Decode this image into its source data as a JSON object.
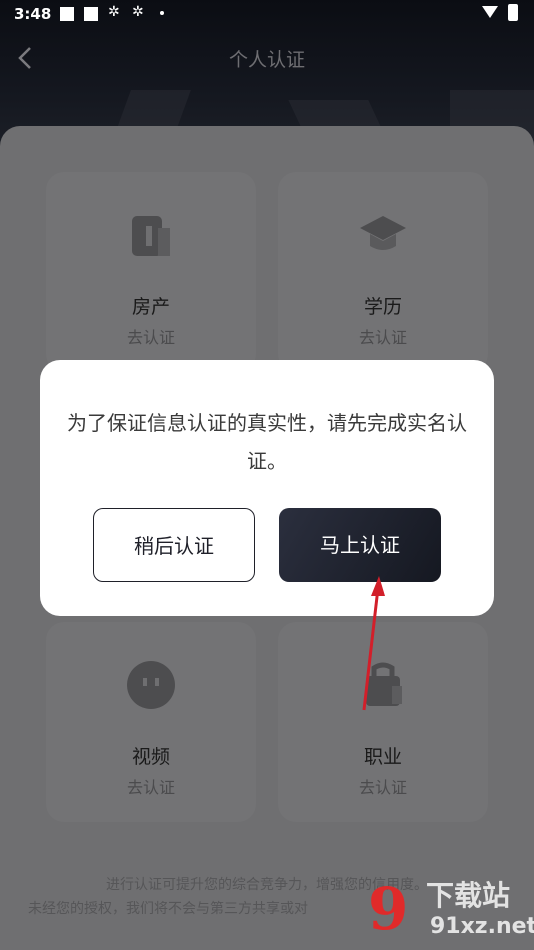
{
  "status": {
    "time": "3:48"
  },
  "nav": {
    "title": "个人认证"
  },
  "cards": [
    {
      "title": "房产",
      "subtitle": "去认证"
    },
    {
      "title": "学历",
      "subtitle": "去认证"
    },
    {
      "title": "视频",
      "subtitle": "去认证"
    },
    {
      "title": "职业",
      "subtitle": "去认证"
    }
  ],
  "footer": {
    "line1": "进行认证可提升您的综合竞争力，增强您的信用度。",
    "line2": "未经您的授权，我们将不会与第三方共享或对"
  },
  "dialog": {
    "message": "为了保证信息认证的真实性，请先完成实名认证。",
    "later_label": "稍后认证",
    "now_label": "马上认证"
  },
  "watermark": {
    "cn": "下载站",
    "en": "91xz.net",
    "logo": "9"
  },
  "colors": {
    "annotation_arrow": "#d21f2a",
    "primary_button": "#1f2230"
  }
}
